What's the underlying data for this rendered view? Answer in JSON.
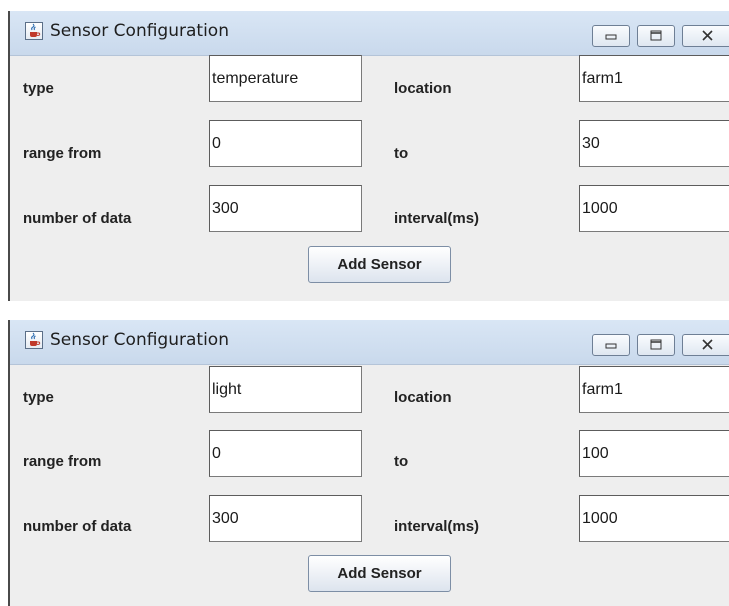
{
  "windows": [
    {
      "title": "Sensor Configuration",
      "labels": {
        "type": "type",
        "location": "location",
        "range_from": "range from",
        "to": "to",
        "number_of_data": "number of data",
        "interval": "interval(ms)"
      },
      "fields": {
        "type": "temperature",
        "location": "farm1",
        "range_from": "0",
        "to": "30",
        "number_of_data": "300",
        "interval": "1000"
      },
      "add_button": "Add Sensor"
    },
    {
      "title": "Sensor Configuration",
      "labels": {
        "type": "type",
        "location": "location",
        "range_from": "range from",
        "to": "to",
        "number_of_data": "number of data",
        "interval": "interval(ms)"
      },
      "fields": {
        "type": "light",
        "location": "farm1",
        "range_from": "0",
        "to": "100",
        "number_of_data": "300",
        "interval": "1000"
      },
      "add_button": "Add Sensor"
    }
  ],
  "icons": {
    "app": "java-cup-icon",
    "minimize": "minimize-icon",
    "maximize": "maximize-icon",
    "close": "close-icon"
  }
}
